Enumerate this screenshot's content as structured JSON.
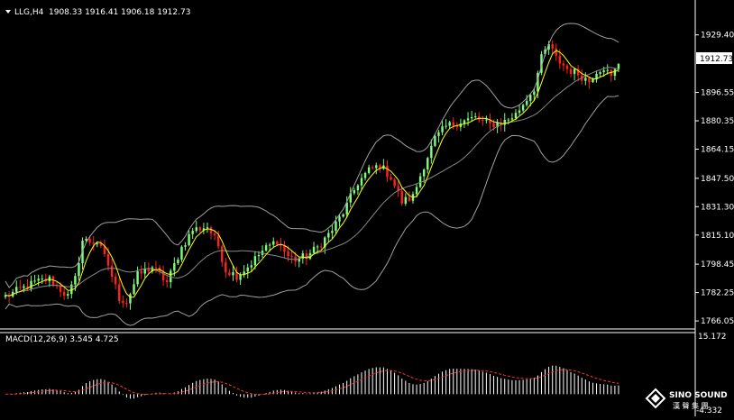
{
  "header": {
    "symbol_label": "LLG,H4",
    "ohlc_label": "1908.33 1916.41 1906.18 1912.73"
  },
  "current_price": "1912.73",
  "macd_label": "MACD(12,26,9) 3.545 4.725",
  "watermark": {
    "brand": "SINO SOUND",
    "sub": "漢 聲 集 團"
  },
  "colors": {
    "background": "#000000",
    "bull": "#7CFC7C",
    "bear": "#FF2020",
    "ma": "#FFFF00",
    "bands": "#A0A0A0",
    "macd_hist": "#FFFFFF",
    "macd_signal": "#FF3030",
    "axis_text": "#FFFFFF",
    "price_box": "#FFFFFF"
  },
  "chart_data": [
    {
      "type": "candlestick",
      "title": "LLG,H4",
      "indicators": [
        "Bollinger Bands",
        "Moving Average"
      ],
      "ylim": [
        1763,
        1938
      ],
      "y_ticks": [
        "1929.40",
        "1912.73",
        "1896.55",
        "1880.35",
        "1864.15",
        "1847.50",
        "1831.30",
        "1815.10",
        "1798.45",
        "1782.25",
        "1766.05"
      ],
      "y_tick_values": [
        1929.4,
        1912.73,
        1896.55,
        1880.35,
        1864.15,
        1847.5,
        1831.3,
        1815.1,
        1798.45,
        1782.25,
        1766.05
      ],
      "waypoints": [
        [
          0,
          1780
        ],
        [
          8,
          1788
        ],
        [
          12,
          1790
        ],
        [
          14,
          1786
        ],
        [
          17,
          1780
        ],
        [
          19,
          1790
        ],
        [
          21,
          1812
        ],
        [
          25,
          1811
        ],
        [
          28,
          1798
        ],
        [
          31,
          1779
        ],
        [
          33,
          1777
        ],
        [
          36,
          1792
        ],
        [
          40,
          1797
        ],
        [
          44,
          1788
        ],
        [
          48,
          1808
        ],
        [
          51,
          1818
        ],
        [
          55,
          1820
        ],
        [
          58,
          1809
        ],
        [
          60,
          1795
        ],
        [
          63,
          1792
        ],
        [
          66,
          1797
        ],
        [
          70,
          1806
        ],
        [
          74,
          1812
        ],
        [
          77,
          1803
        ],
        [
          79,
          1801
        ],
        [
          82,
          1803
        ],
        [
          85,
          1808
        ],
        [
          89,
          1818
        ],
        [
          92,
          1828
        ],
        [
          96,
          1845
        ],
        [
          99,
          1852
        ],
        [
          102,
          1855
        ],
        [
          105,
          1848
        ],
        [
          108,
          1834
        ],
        [
          111,
          1837
        ],
        [
          114,
          1855
        ],
        [
          117,
          1870
        ],
        [
          120,
          1877
        ],
        [
          124,
          1880
        ],
        [
          128,
          1882
        ],
        [
          132,
          1878
        ],
        [
          136,
          1880
        ],
        [
          139,
          1884
        ],
        [
          141,
          1890
        ],
        [
          144,
          1899
        ],
        [
          146,
          1916
        ],
        [
          148,
          1924
        ],
        [
          150,
          1916
        ],
        [
          153,
          1910
        ],
        [
          156,
          1907
        ],
        [
          159,
          1903
        ],
        [
          161,
          1909
        ],
        [
          163,
          1911
        ],
        [
          165,
          1905
        ],
        [
          167,
          1912.73
        ]
      ]
    },
    {
      "type": "macd",
      "title": "MACD(12,26,9) 3.545 4.725",
      "macd": 3.545,
      "signal": 4.725,
      "ylim": [
        -4.332,
        15.172
      ],
      "y_ticks": [
        "15.172",
        "-4.332"
      ]
    }
  ]
}
